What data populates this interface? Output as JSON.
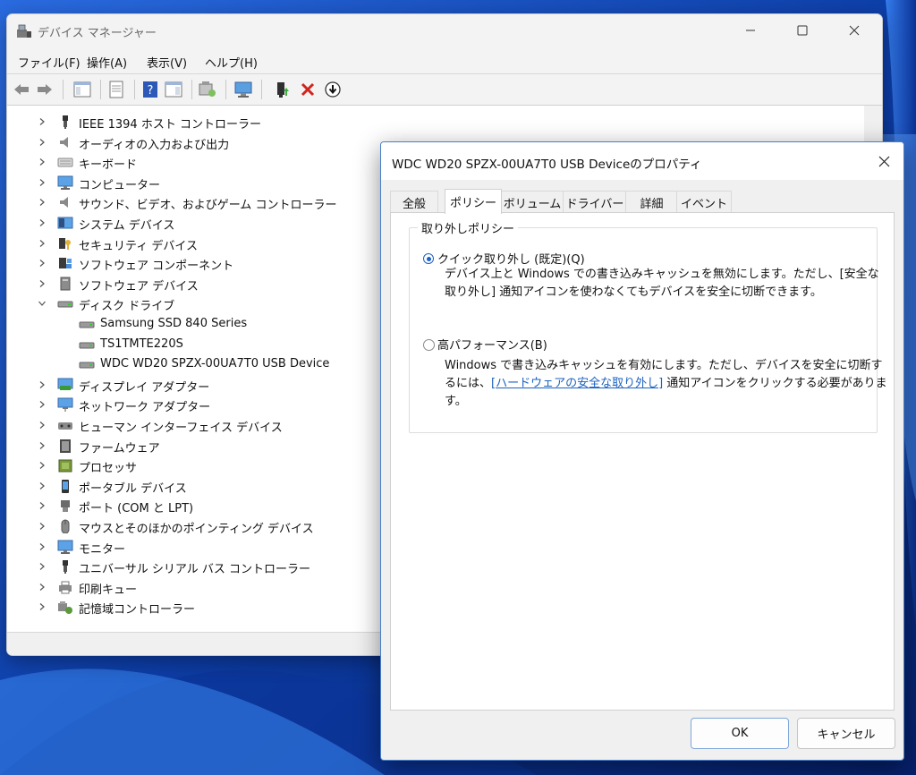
{
  "device_manager": {
    "title": "デバイス マネージャー",
    "menu": [
      "ファイル(F)",
      "操作(A)",
      "表示(V)",
      "ヘルプ(H)"
    ],
    "tree": [
      {
        "label": "IEEE 1394 ホスト コントローラー",
        "icon": "usb-plug-icon",
        "expanded": false
      },
      {
        "label": "オーディオの入力および出力",
        "icon": "speaker-icon",
        "expanded": false
      },
      {
        "label": "キーボード",
        "icon": "keyboard-icon",
        "expanded": false
      },
      {
        "label": "コンピューター",
        "icon": "monitor-icon",
        "expanded": false
      },
      {
        "label": "サウンド、ビデオ、およびゲーム コントローラー",
        "icon": "speaker-icon",
        "expanded": false
      },
      {
        "label": "システム デバイス",
        "icon": "system-device-icon",
        "expanded": false
      },
      {
        "label": "セキュリティ デバイス",
        "icon": "security-key-icon",
        "expanded": false
      },
      {
        "label": "ソフトウェア コンポーネント",
        "icon": "software-component-icon",
        "expanded": false
      },
      {
        "label": "ソフトウェア デバイス",
        "icon": "software-device-icon",
        "expanded": false
      },
      {
        "label": "ディスク ドライブ",
        "icon": "disk-drive-icon",
        "expanded": true
      },
      {
        "label": "Samsung SSD 840 Series",
        "icon": "disk-drive-icon",
        "child": true
      },
      {
        "label": "TS1TMTE220S",
        "icon": "disk-drive-icon",
        "child": true
      },
      {
        "label": "WDC WD20 SPZX-00UA7T0 USB Device",
        "icon": "disk-drive-icon",
        "child": true
      },
      {
        "label": "ディスプレイ アダプター",
        "icon": "display-adapter-icon",
        "expanded": false
      },
      {
        "label": "ネットワーク アダプター",
        "icon": "network-adapter-icon",
        "expanded": false
      },
      {
        "label": "ヒューマン インターフェイス デバイス",
        "icon": "hid-icon",
        "expanded": false
      },
      {
        "label": "ファームウェア",
        "icon": "firmware-icon",
        "expanded": false
      },
      {
        "label": "プロセッサ",
        "icon": "processor-icon",
        "expanded": false
      },
      {
        "label": "ポータブル デバイス",
        "icon": "portable-device-icon",
        "expanded": false
      },
      {
        "label": "ポート (COM と LPT)",
        "icon": "port-icon",
        "expanded": false
      },
      {
        "label": "マウスとそのほかのポインティング デバイス",
        "icon": "mouse-icon",
        "expanded": false
      },
      {
        "label": "モニター",
        "icon": "monitor-icon",
        "expanded": false
      },
      {
        "label": "ユニバーサル シリアル バス コントローラー",
        "icon": "usb-plug-icon",
        "expanded": false
      },
      {
        "label": "印刷キュー",
        "icon": "printer-icon",
        "expanded": false
      },
      {
        "label": "記憶域コントローラー",
        "icon": "storage-controller-icon",
        "expanded": false
      }
    ]
  },
  "dialog": {
    "title": "WDC WD20 SPZX-00UA7T0 USB Deviceのプロパティ",
    "tabs": [
      "全般",
      "ポリシー",
      "ボリューム",
      "ドライバー",
      "詳細",
      "イベント"
    ],
    "active_tab": "ポリシー",
    "group_title": "取り外しポリシー",
    "option_quick": {
      "label": "クイック取り外し (既定)(Q)",
      "checked": true,
      "desc_line1": "デバイス上と Windows での書き込みキャッシュを無効にします。ただし、[安全な",
      "desc_line2": "取り外し] 通知アイコンを使わなくてもデバイスを安全に切断できます。"
    },
    "option_perf": {
      "label": "高パフォーマンス(B)",
      "checked": false,
      "desc_line1": "Windows で書き込みキャッシュを有効にします。ただし、デバイスを安全に切断す",
      "desc_line2_pre": "るには、",
      "desc_link": "[ハードウェアの安全な取り外し]",
      "desc_line2_post": " 通知アイコンをクリックする必要がありま",
      "desc_line3": "す。"
    },
    "ok_label": "OK",
    "cancel_label": "キャンセル"
  },
  "colors": {
    "accent": "#1d60c6",
    "link": "#1b62c0",
    "dialog_border": "#4a7ec8"
  }
}
